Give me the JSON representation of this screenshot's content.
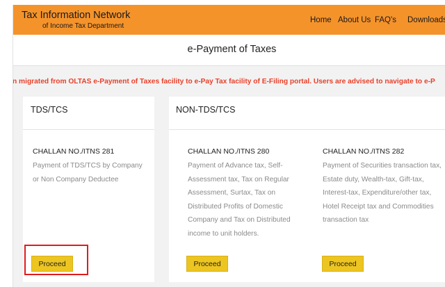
{
  "header": {
    "title": "Tax Information Network",
    "subtitle": "of Income Tax Department",
    "nav": [
      "Home",
      "About Us",
      "FAQ's",
      "Downloads"
    ],
    "background_color": "#f5932b"
  },
  "page_title": "e-Payment of Taxes",
  "notice": "n migrated from OLTAS e-Payment of Taxes facility to e-Pay Tax facility of E-Filing portal. Users are advised to navigate to e-P",
  "cards": [
    {
      "title": "TDS/TCS",
      "challans": [
        {
          "title": "CHALLAN NO./ITNS 281",
          "description_lines": [
            "Payment of TDS/TCS by Company",
            "or Non Company Deductee"
          ],
          "button": "Proceed"
        }
      ]
    },
    {
      "title": "NON-TDS/TCS",
      "challans": [
        {
          "title": "CHALLAN NO./ITNS 280",
          "description_lines": [
            "Payment of Advance tax, Self-",
            "Assessment tax, Tax on Regular",
            "Assessment, Surtax, Tax on",
            "Distributed Profits of Domestic",
            "Company and Tax on Distributed",
            "income to unit holders."
          ],
          "button": "Proceed"
        },
        {
          "title": "CHALLAN NO./ITNS 282",
          "description_lines": [
            "Payment of Securities transaction tax,",
            "Estate duty, Wealth-tax, Gift-tax,",
            "Interest-tax, Expenditure/other tax,",
            "Hotel Receipt tax and Commodities",
            "transaction tax"
          ],
          "button": "Proceed"
        }
      ]
    }
  ],
  "colors": {
    "accent": "#f5932b",
    "notice_text": "#e8402a",
    "button": "#edc521",
    "highlight": "#e01b1b"
  }
}
